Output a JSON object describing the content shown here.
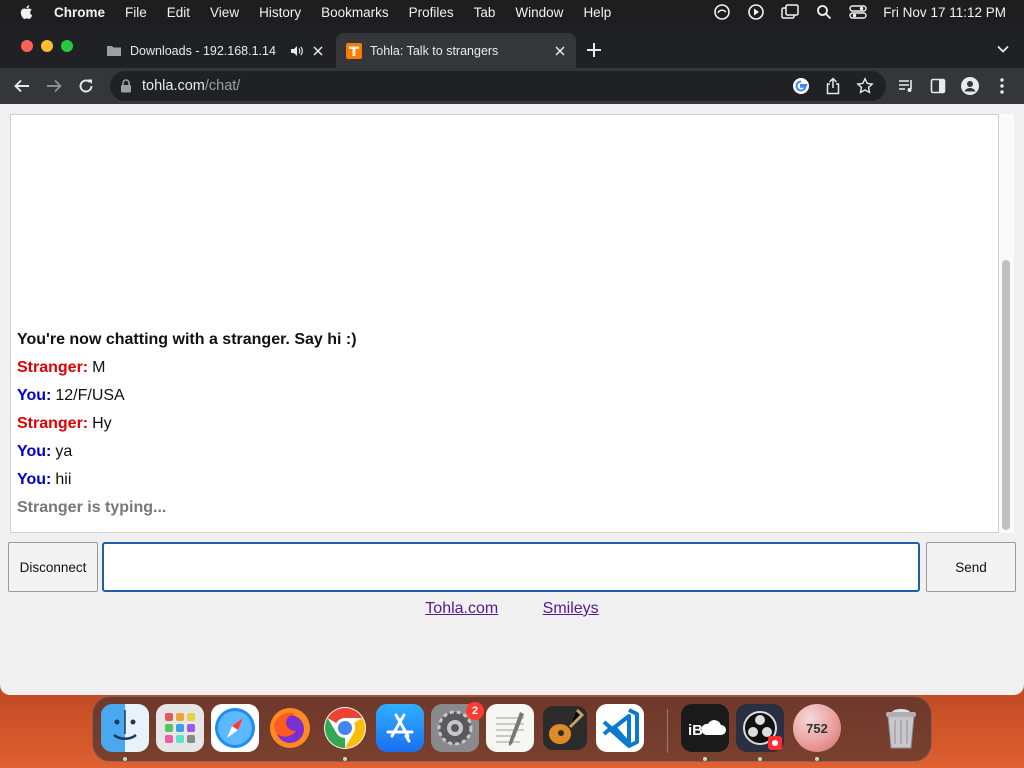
{
  "menubar": {
    "app_name": "Chrome",
    "menus": [
      "File",
      "Edit",
      "View",
      "History",
      "Bookmarks",
      "Profiles",
      "Tab",
      "Window",
      "Help"
    ],
    "clock": "Fri Nov 17  11:12 PM"
  },
  "browser": {
    "tabs": [
      {
        "title": "Downloads - 192.168.1.14",
        "active": false,
        "audio": true
      },
      {
        "title": "Tohla: Talk to strangers",
        "active": true,
        "audio": false
      }
    ],
    "url_host": "tohla.com",
    "url_path": "/chat/"
  },
  "chat": {
    "status": "You're now chatting with a stranger. Say hi :)",
    "stranger_label": "Stranger:",
    "you_label": "You:",
    "messages": [
      {
        "from": "stranger",
        "text": "M"
      },
      {
        "from": "you",
        "text": "12/F/USA"
      },
      {
        "from": "stranger",
        "text": "Hy"
      },
      {
        "from": "you",
        "text": "ya"
      },
      {
        "from": "you",
        "text": "hii"
      }
    ],
    "typing": "Stranger is typing...",
    "input_value": "",
    "disconnect_label": "Disconnect",
    "send_label": "Send",
    "footer_links": [
      "Tohla.com",
      "Smileys"
    ]
  },
  "dock": {
    "apps": [
      "Finder",
      "Launchpad",
      "Safari",
      "Firefox",
      "Chrome",
      "App Store",
      "System Preferences",
      "TextEdit",
      "GarageBand",
      "Visual Studio Code",
      "iBoostUp",
      "OBS",
      "752",
      "Trash"
    ],
    "settings_badge": "2",
    "counter_label": "752"
  },
  "colors": {
    "stranger": "#e00000",
    "you": "#0000c8",
    "link": "#551a8b",
    "input_focus": "#1f5fa8"
  }
}
